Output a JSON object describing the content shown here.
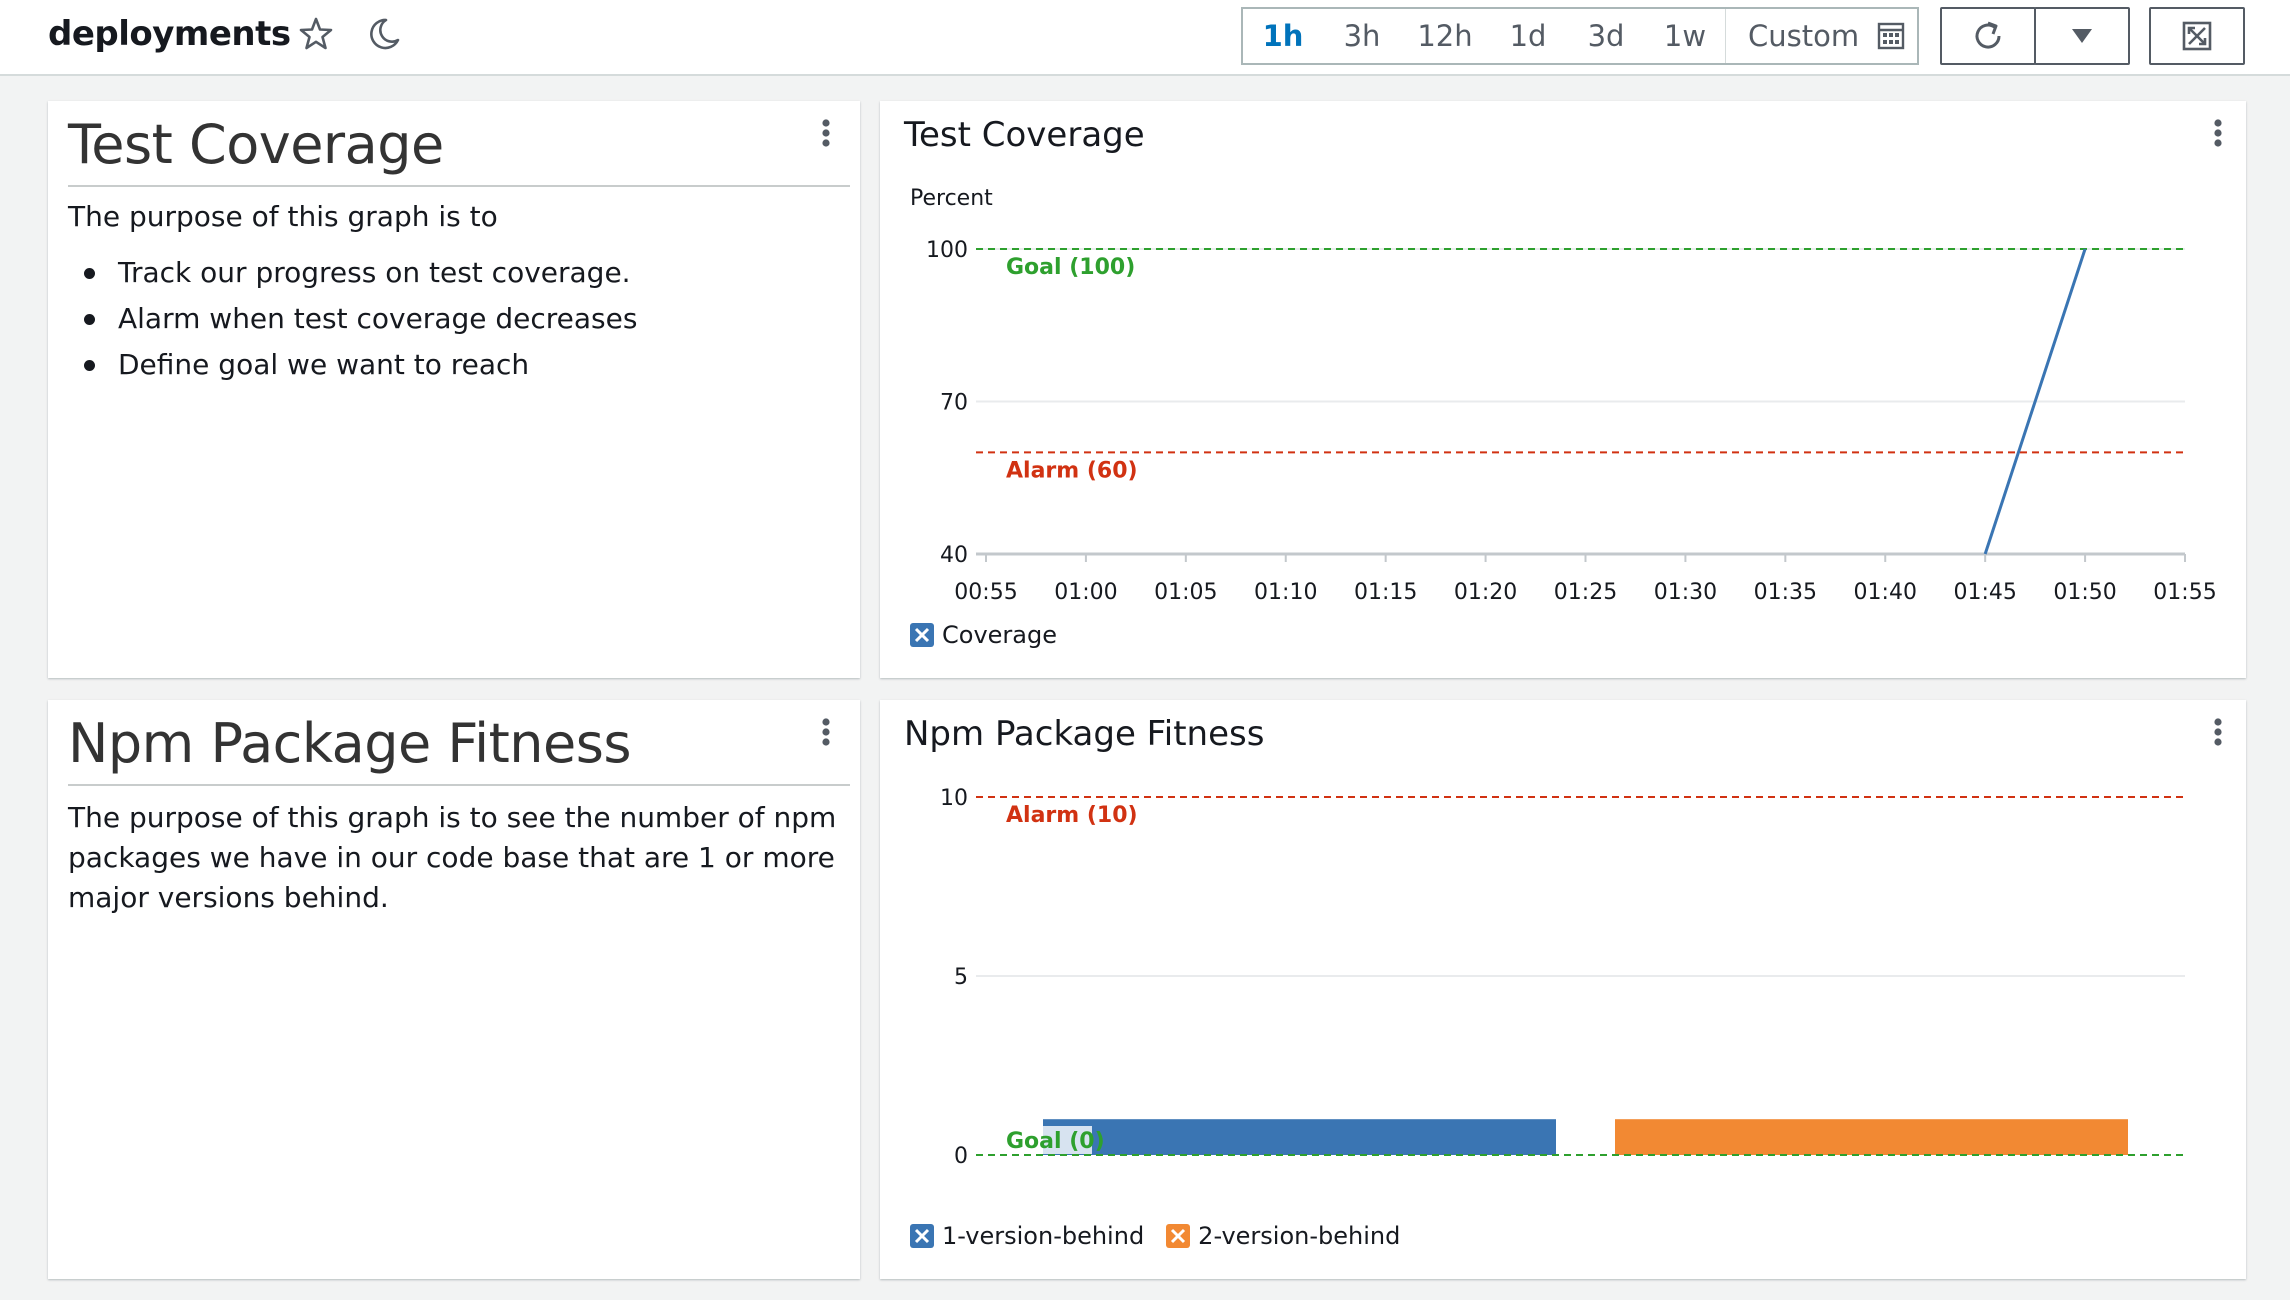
{
  "header": {
    "title": "deployments",
    "star_icon": "star-icon",
    "dark_mode_icon": "moon-icon",
    "time_ranges": [
      "1h",
      "3h",
      "12h",
      "1d",
      "3d",
      "1w"
    ],
    "active_range": "1h",
    "custom_label": "Custom",
    "calendar_icon": "calendar-icon",
    "refresh_icon": "refresh-icon",
    "dropdown_icon": "caret-down-icon",
    "fullscreen_icon": "fullscreen-icon"
  },
  "text_widgets": [
    {
      "heading": "Test Coverage",
      "intro": "The purpose of this graph is to",
      "bullets": [
        "Track our progress on test coverage.",
        "Alarm when test coverage decreases",
        "Define goal we want to reach"
      ]
    },
    {
      "heading": "Npm Package Fitness",
      "body": "The purpose of this graph is to see the number of npm packages we have in our code base that are 1 or more major versions behind."
    }
  ],
  "colors": {
    "blue": "#3a75b3",
    "orange": "#f28933",
    "goal_green": "#2ea02e",
    "alarm_red": "#d13212",
    "grid": "#e9ebed"
  },
  "chart_data": [
    {
      "type": "line",
      "title": "Test Coverage",
      "ylabel": "Percent",
      "xlabel": "",
      "ylim": [
        40,
        100
      ],
      "y_ticks": [
        "40",
        "70",
        "100"
      ],
      "x_ticks": [
        "00:55",
        "01:00",
        "01:05",
        "01:10",
        "01:15",
        "01:20",
        "01:25",
        "01:30",
        "01:35",
        "01:40",
        "01:45",
        "01:50",
        "01:55"
      ],
      "series": [
        {
          "name": "Coverage",
          "x": [
            "01:45",
            "01:50"
          ],
          "values": [
            40,
            100
          ]
        }
      ],
      "annotations": [
        {
          "label": "Goal (100)",
          "value": 100
        },
        {
          "label": "Alarm (60)",
          "value": 60
        }
      ],
      "grid": true,
      "legend": "bottom-left"
    },
    {
      "type": "bar",
      "title": "Npm Package Fitness",
      "xlabel": "",
      "ylabel": "",
      "ylim": [
        0,
        10
      ],
      "y_ticks": [
        "0",
        "5",
        "10"
      ],
      "series": [
        {
          "name": "1-version-behind",
          "values": [
            1
          ]
        },
        {
          "name": "2-version-behind",
          "values": [
            1
          ]
        }
      ],
      "annotations": [
        {
          "label": "Alarm (10)",
          "value": 10
        },
        {
          "label": "Goal (0)",
          "value": 0
        }
      ],
      "grid": true,
      "legend": "bottom-left"
    }
  ]
}
